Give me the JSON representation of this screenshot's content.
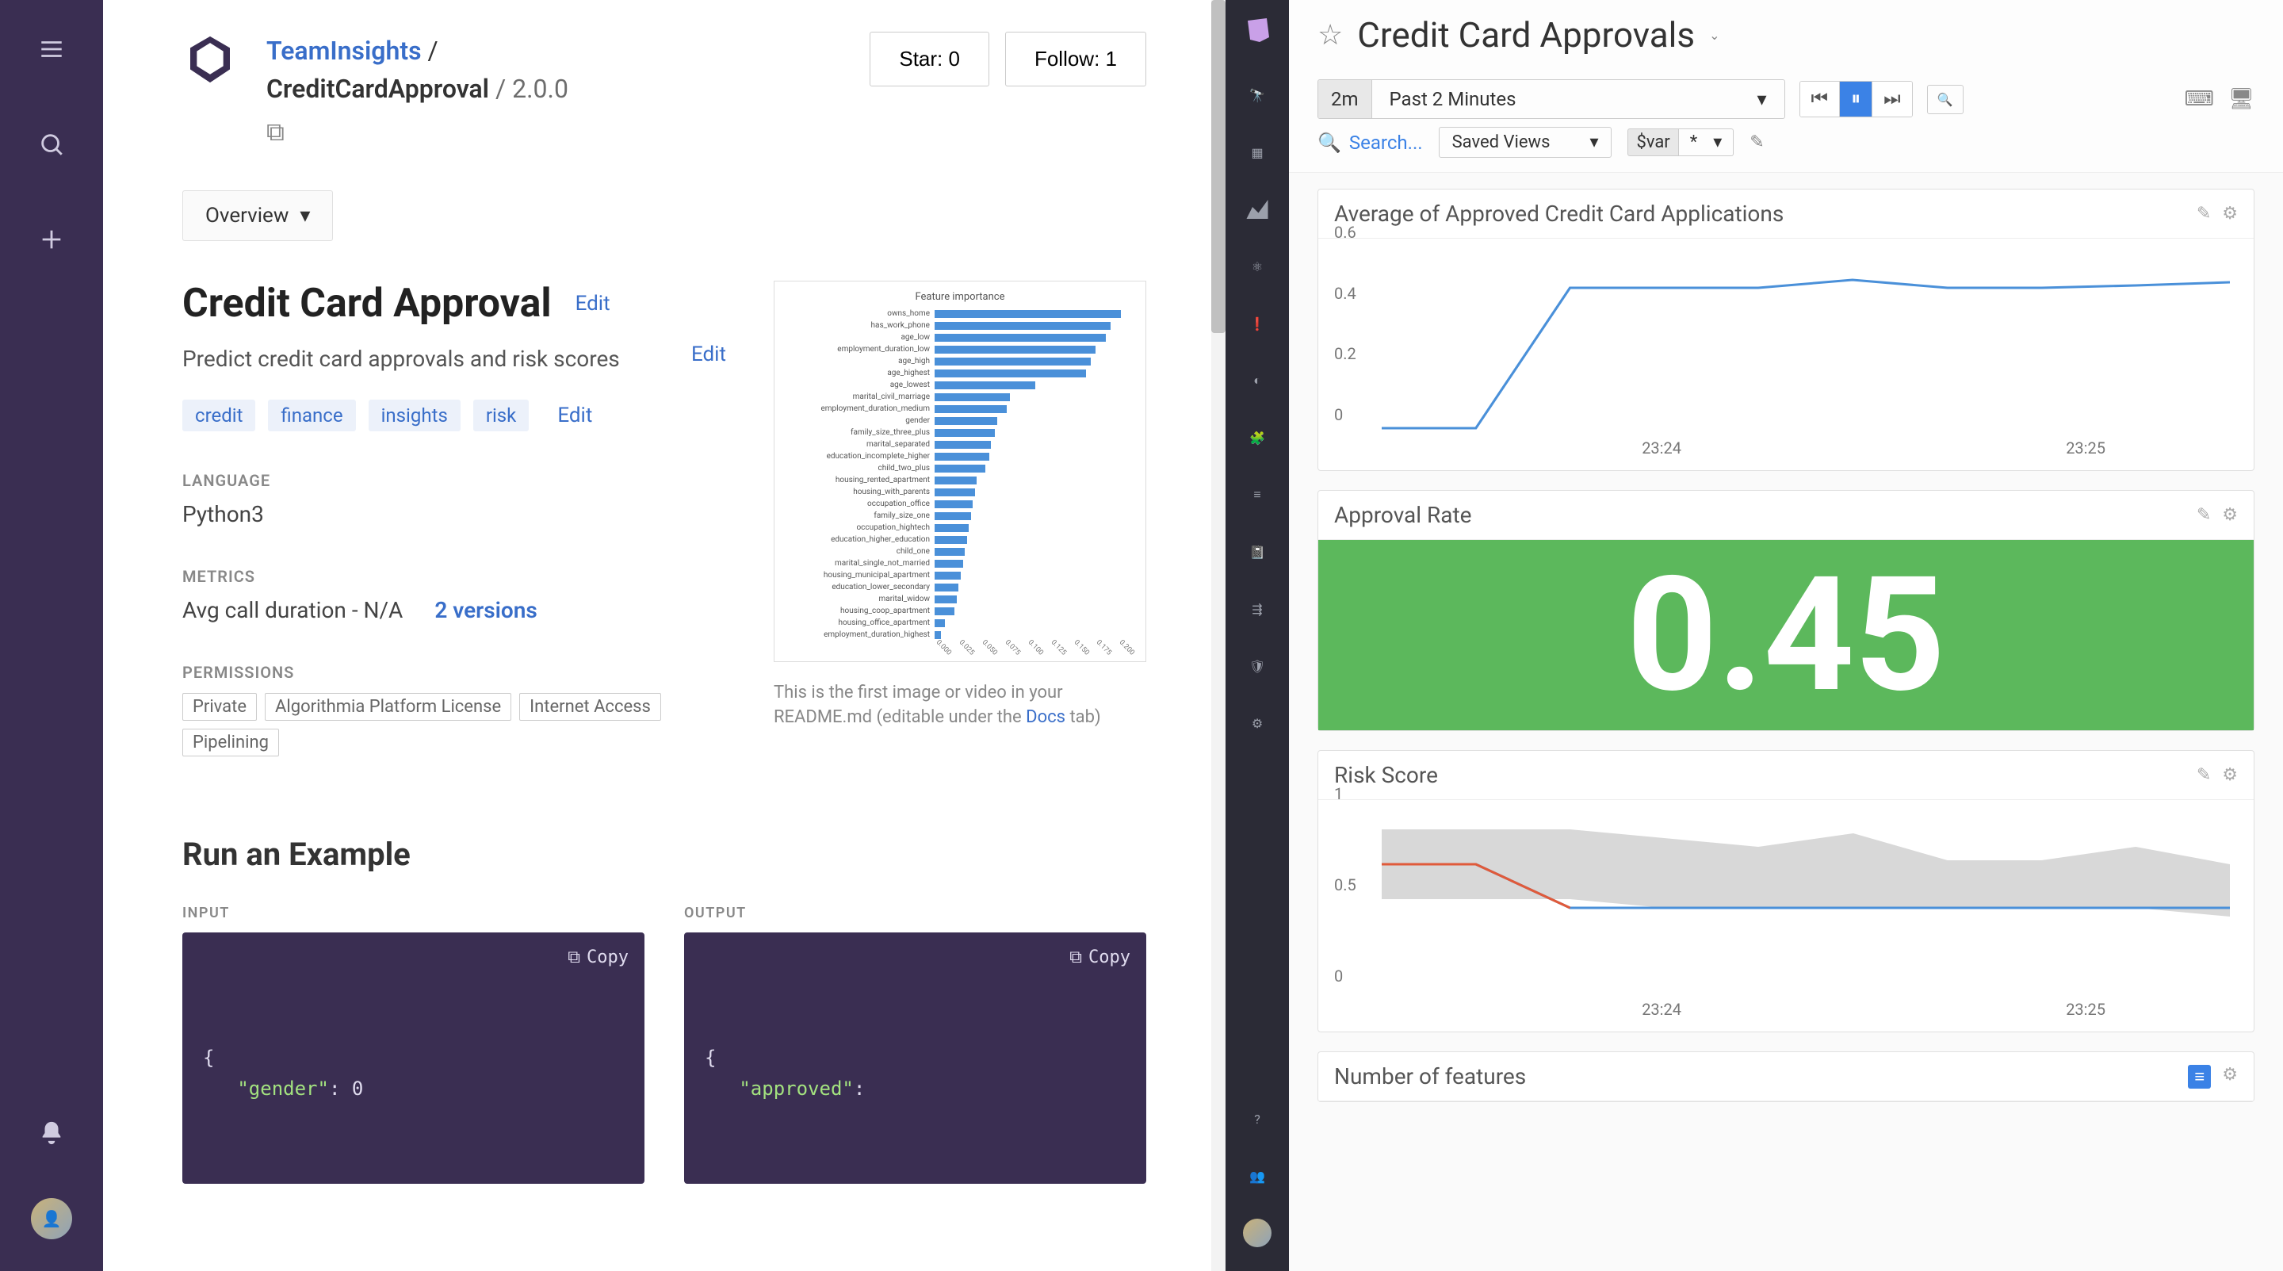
{
  "algo": {
    "breadcrumb": {
      "org": "TeamInsights",
      "sep": "/",
      "model": "CreditCardApproval",
      "version": "/ 2.0.0"
    },
    "actions": {
      "star": "Star: 0",
      "follow": "Follow: 1"
    },
    "overview_label": "Overview",
    "title": "Credit Card Approval",
    "description": "Predict credit card approvals and risk scores",
    "edit": "Edit",
    "tags": [
      "credit",
      "finance",
      "insights",
      "risk"
    ],
    "language_label": "LANGUAGE",
    "language": "Python3",
    "metrics_label": "METRICS",
    "metrics_value": "Avg call duration - N/A",
    "versions_link": "2 versions",
    "permissions_label": "PERMISSIONS",
    "permissions": [
      "Private",
      "Algorithmia Platform License",
      "Internet Access",
      "Pipelining"
    ],
    "readme_note_1": "This is the first image or video in your README.md (editable under the ",
    "readme_note_link": "Docs",
    "readme_note_2": " tab)",
    "run_title": "Run an Example",
    "input_label": "INPUT",
    "output_label": "OUTPUT",
    "copy": "Copy",
    "input_code": "{\n   \"gender\": 0",
    "output_code": "{\n   \"approved\":"
  },
  "feature_chart": {
    "title": "Feature importance",
    "features": [
      {
        "name": "owns_home",
        "v": 0.185
      },
      {
        "name": "has_work_phone",
        "v": 0.175
      },
      {
        "name": "age_low",
        "v": 0.17
      },
      {
        "name": "employment_duration_low",
        "v": 0.16
      },
      {
        "name": "age_high",
        "v": 0.155
      },
      {
        "name": "age_highest",
        "v": 0.15
      },
      {
        "name": "age_lowest",
        "v": 0.1
      },
      {
        "name": "marital_civil_marriage",
        "v": 0.075
      },
      {
        "name": "employment_duration_medium",
        "v": 0.072
      },
      {
        "name": "gender",
        "v": 0.062
      },
      {
        "name": "family_size_three_plus",
        "v": 0.06
      },
      {
        "name": "marital_separated",
        "v": 0.056
      },
      {
        "name": "education_incomplete_higher",
        "v": 0.054
      },
      {
        "name": "child_two_plus",
        "v": 0.05
      },
      {
        "name": "housing_rented_apartment",
        "v": 0.042
      },
      {
        "name": "housing_with_parents",
        "v": 0.04
      },
      {
        "name": "occupation_office",
        "v": 0.038
      },
      {
        "name": "family_size_one",
        "v": 0.036
      },
      {
        "name": "occupation_hightech",
        "v": 0.034
      },
      {
        "name": "education_higher_education",
        "v": 0.032
      },
      {
        "name": "child_one",
        "v": 0.03
      },
      {
        "name": "marital_single_not_married",
        "v": 0.028
      },
      {
        "name": "housing_municipal_apartment",
        "v": 0.026
      },
      {
        "name": "education_lower_secondary",
        "v": 0.024
      },
      {
        "name": "marital_widow",
        "v": 0.022
      },
      {
        "name": "housing_coop_apartment",
        "v": 0.02
      },
      {
        "name": "housing_office_apartment",
        "v": 0.01
      },
      {
        "name": "employment_duration_highest",
        "v": 0.006
      }
    ],
    "xticks": [
      "0.000",
      "0.025",
      "0.050",
      "0.075",
      "0.100",
      "0.125",
      "0.150",
      "0.175",
      "0.200"
    ]
  },
  "dd": {
    "title": "Credit Card Approvals",
    "time_short": "2m",
    "time_label": "Past 2 Minutes",
    "search": "Search...",
    "saved_views": "Saved Views",
    "var_label": "$var",
    "var_value": "*",
    "widgets": {
      "avg": {
        "title": "Average of Approved Credit Card Applications",
        "yticks": [
          "0",
          "0.2",
          "0.4",
          "0.6"
        ],
        "xticks": [
          "23:24",
          "23:25"
        ]
      },
      "rate": {
        "title": "Approval Rate",
        "value": "0.45"
      },
      "risk": {
        "title": "Risk Score",
        "yticks": [
          "0",
          "0.5",
          "1"
        ],
        "xticks": [
          "23:24",
          "23:25"
        ]
      },
      "nfeat": {
        "title": "Number of features"
      }
    }
  },
  "chart_data": [
    {
      "type": "bar",
      "orientation": "horizontal",
      "title": "Feature importance",
      "xlabel": "",
      "ylabel": "",
      "xlim": [
        0,
        0.2
      ],
      "categories": [
        "owns_home",
        "has_work_phone",
        "age_low",
        "employment_duration_low",
        "age_high",
        "age_highest",
        "age_lowest",
        "marital_civil_marriage",
        "employment_duration_medium",
        "gender",
        "family_size_three_plus",
        "marital_separated",
        "education_incomplete_higher",
        "child_two_plus",
        "housing_rented_apartment",
        "housing_with_parents",
        "occupation_office",
        "family_size_one",
        "occupation_hightech",
        "education_higher_education",
        "child_one",
        "marital_single_not_married",
        "housing_municipal_apartment",
        "education_lower_secondary",
        "marital_widow",
        "housing_coop_apartment",
        "housing_office_apartment",
        "employment_duration_highest"
      ],
      "values": [
        0.185,
        0.175,
        0.17,
        0.16,
        0.155,
        0.15,
        0.1,
        0.075,
        0.072,
        0.062,
        0.06,
        0.056,
        0.054,
        0.05,
        0.042,
        0.04,
        0.038,
        0.036,
        0.034,
        0.032,
        0.03,
        0.028,
        0.026,
        0.024,
        0.022,
        0.02,
        0.01,
        0.006
      ]
    },
    {
      "type": "line",
      "title": "Average of Approved Credit Card Applications",
      "ylim": [
        0,
        0.6
      ],
      "xticks": [
        "23:24",
        "23:25"
      ],
      "series": [
        {
          "name": "avg",
          "values": [
            0.02,
            0.02,
            0.5,
            0.5,
            0.5,
            0.53,
            0.5,
            0.5,
            0.51,
            0.52
          ]
        }
      ]
    },
    {
      "type": "bignumber",
      "title": "Approval Rate",
      "value": 0.45
    },
    {
      "type": "line",
      "title": "Risk Score",
      "ylim": [
        0,
        1
      ],
      "xticks": [
        "23:24",
        "23:25"
      ],
      "series": [
        {
          "name": "threshold",
          "values": [
            0.75,
            0.5,
            0.5,
            0.5,
            0.5,
            0.5,
            0.5,
            0.5,
            0.5,
            0.5
          ]
        },
        {
          "name": "band_upper",
          "values": [
            0.95,
            0.95,
            0.95,
            0.9,
            0.85,
            0.93,
            0.77,
            0.77,
            0.85,
            0.75
          ]
        },
        {
          "name": "band_lower",
          "values": [
            0.55,
            0.55,
            0.55,
            0.5,
            0.5,
            0.5,
            0.5,
            0.5,
            0.5,
            0.45
          ]
        }
      ]
    }
  ]
}
